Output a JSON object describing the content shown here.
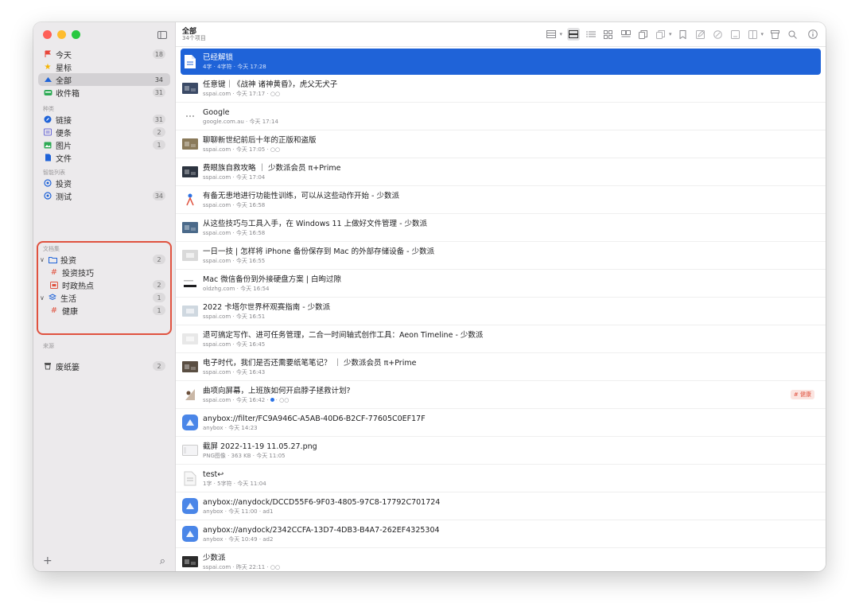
{
  "sidebar": {
    "items": [
      {
        "label": "今天",
        "count": "18",
        "icon": "flag-icon",
        "color": "#e8463a"
      },
      {
        "label": "星标",
        "count": "",
        "icon": "star-icon",
        "color": "#f5b400"
      },
      {
        "label": "全部",
        "count": "34",
        "icon": "cloud-icon",
        "color": "#1f63d8"
      },
      {
        "label": "收件箱",
        "count": "31",
        "icon": "inbox-icon",
        "color": "#2eaa55"
      }
    ],
    "types_header": "种类",
    "types": [
      {
        "label": "链接",
        "count": "31",
        "icon": "link-icon",
        "color": "#1f63d8"
      },
      {
        "label": "便条",
        "count": "2",
        "icon": "note-icon",
        "color": "#6b6bd6"
      },
      {
        "label": "图片",
        "count": "1",
        "icon": "image-icon",
        "color": "#2eaa55"
      },
      {
        "label": "文件",
        "count": "",
        "icon": "file-icon",
        "color": "#1f63d8"
      }
    ],
    "smart_header": "智能列表",
    "smart": [
      {
        "label": "投资",
        "count": "",
        "icon": "gear-icon",
        "color": "#1f63d8"
      },
      {
        "label": "测试",
        "count": "34",
        "icon": "gear-icon",
        "color": "#1f63d8"
      }
    ],
    "collections_header": "文档集",
    "collections": [
      {
        "label": "投资",
        "count": "2",
        "icon": "folder-icon",
        "level": 0,
        "chevron": "∨"
      },
      {
        "label": "投资技巧",
        "count": "",
        "icon": "hash-icon",
        "level": 1
      },
      {
        "label": "时政热点",
        "count": "2",
        "icon": "tray-icon",
        "level": 1
      },
      {
        "label": "生活",
        "count": "1",
        "icon": "stack-icon",
        "level": 0,
        "chevron": "∨"
      },
      {
        "label": "健康",
        "count": "1",
        "icon": "hash-icon",
        "level": 1
      }
    ],
    "sources_header": "来源",
    "trash": {
      "label": "废纸篓",
      "count": "2"
    },
    "add": "+",
    "search": "⌕"
  },
  "toolbar": {
    "title": "全部",
    "subtitle": "34个项目"
  },
  "rows": [
    {
      "title": "已经解锁",
      "meta": "4字 · 4字符 · 今天 17:28",
      "thumb": "doc",
      "selected": true
    },
    {
      "title": "任意键｜《战神 诸神黄昏》，虎父无犬子",
      "meta": "sspai.com · 今天 17:17 · ○○",
      "thumb": "photo",
      "color": "#3b4a66"
    },
    {
      "title": "Google",
      "meta": "google.com.au · 今天 17:14",
      "thumb": "dots"
    },
    {
      "title": "聊聊新世纪前后十年的正版和盗版",
      "meta": "sspai.com · 今天 17:05 · ○○",
      "thumb": "photo",
      "color": "#8a7a5a"
    },
    {
      "title": "费眼族自救攻略 ｜ 少数派会员 π+Prime",
      "meta": "sspai.com · 今天 17:04",
      "thumb": "photo",
      "color": "#2c3440"
    },
    {
      "title": "有备无患地进行功能性训练，可以从这些动作开始 - 少数派",
      "meta": "sspai.com · 今天 16:58",
      "thumb": "figure"
    },
    {
      "title": "从这些技巧与工具入手，在 Windows 11 上做好文件管理 - 少数派",
      "meta": "sspai.com · 今天 16:58",
      "thumb": "photo",
      "color": "#4b6a8a"
    },
    {
      "title": "一日一技 | 怎样将 iPhone 备份保存到 Mac 的外部存储设备 - 少数派",
      "meta": "sspai.com · 今天 16:55",
      "thumb": "light",
      "color": "#d9d9d9"
    },
    {
      "title": "Mac 微信备份到外接硬盘方案 | 白昫过隙",
      "meta": "oldzhg.com · 今天 16:54",
      "thumb": "bar"
    },
    {
      "title": "2022 卡塔尔世界杯观赛指南 - 少数派",
      "meta": "sspai.com · 今天 16:51",
      "thumb": "light",
      "color": "#cfd8e0"
    },
    {
      "title": "退可搞定写作、进可任务管理，二合一时间轴式创作工具：Aeon Timeline - 少数派",
      "meta": "sspai.com · 今天 16:45",
      "thumb": "light",
      "color": "#e8e8e8"
    },
    {
      "title": "电子时代，我们是否还需要纸笔笔记？ ｜ 少数派会员 π+Prime",
      "meta": "sspai.com · 今天 16:43",
      "thumb": "photo",
      "color": "#5a4e42"
    },
    {
      "title": "曲项向屏幕，上班族如何开启脖子拯救计划?",
      "meta": "sspai.com · 今天 16:42 ·",
      "meta2": "· ○○",
      "thumb": "figure2",
      "tag": "# 健康"
    },
    {
      "title": "anybox://filter/FC9A946C-A5AB-40D6-B2CF-77605C0EF17F",
      "meta": "anybox · 今天 14:23",
      "thumb": "anybox"
    },
    {
      "title": "截屏 2022-11-19 11.05.27.png",
      "meta": "PNG图像 · 363 KB · 今天 11:05",
      "thumb": "shot"
    },
    {
      "title": "test↩",
      "meta": "1字 · 5字符 · 今天 11:04",
      "thumb": "note"
    },
    {
      "title": "anybox://anydock/DCCD55F6-9F03-4805-97C8-17792C701724",
      "meta": "anybox · 今天 11:00 · ad1",
      "thumb": "anybox"
    },
    {
      "title": "anybox://anydock/2342CCFA-13D7-4DB3-B4A7-262EF4325304",
      "meta": "anybox · 今天 10:49 · ad2",
      "thumb": "anybox"
    },
    {
      "title": "少数派",
      "meta": "sspai.com · 昨天 22:11 · ○○",
      "thumb": "photo",
      "color": "#2b2b2b"
    }
  ]
}
